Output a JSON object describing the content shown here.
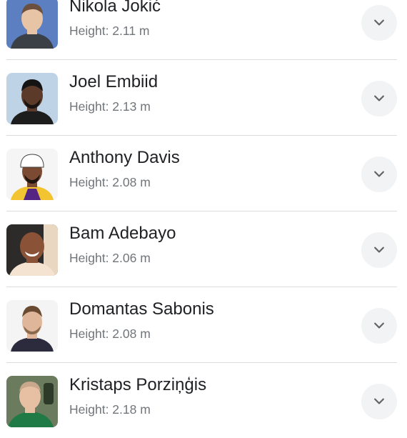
{
  "players": [
    {
      "name": "Nikola Jokić",
      "height": "Height: 2.11 m",
      "photo": "player-photo",
      "bg": "#5b7fc0",
      "skin": "#e8c4a6",
      "shirt": "#3b3f46"
    },
    {
      "name": "Joel Embiid",
      "height": "Height: 2.13 m",
      "photo": "player-photo",
      "bg": "#bfd3e6",
      "skin": "#5b3a29",
      "shirt": "#1d1d1d"
    },
    {
      "name": "Anthony Davis",
      "height": "Height: 2.08 m",
      "photo": "player-photo",
      "bg": "#f5f5f5",
      "skin": "#7a4a32",
      "shirt": "#f3c431"
    },
    {
      "name": "Bam Adebayo",
      "height": "Height: 2.06 m",
      "photo": "player-photo",
      "bg": "#2d2a2a",
      "skin": "#8a5236",
      "shirt": "#f3e3d0"
    },
    {
      "name": "Domantas Sabonis",
      "height": "Height: 2.08 m",
      "photo": "player-photo",
      "bg": "#f4f4f4",
      "skin": "#e0b69a",
      "shirt": "#2b2b3d"
    },
    {
      "name": "Kristaps Porziņģis",
      "height": "Height: 2.18 m",
      "photo": "player-photo",
      "bg": "#6a7b5e",
      "skin": "#e7c0a3",
      "shirt": "#1f7a46"
    }
  ],
  "expand_icon": "chevron-down-icon"
}
